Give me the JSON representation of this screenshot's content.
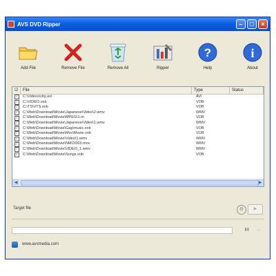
{
  "window": {
    "title": "AVS DVD Ripper"
  },
  "toolbar": {
    "add_file": "Add File",
    "remove_file": "Remove File",
    "remove_all": "Remove All",
    "ripper": "Ripper",
    "help": "Help",
    "about": "About"
  },
  "list": {
    "headers": {
      "file": "File",
      "type": "Type",
      "status": "Status"
    },
    "rows": [
      {
        "file": "C:\\Videos\\clip.avi",
        "type": "AVI"
      },
      {
        "file": "C:\\VIDEO.vob",
        "type": "VOB"
      },
      {
        "file": "C:\\TS\\VTS.vob",
        "type": "VOB"
      },
      {
        "file": "C:\\Web\\Download\\Movie\\Japanese\\Video\\2.wmv",
        "type": "WMV"
      },
      {
        "file": "C:\\Web\\Download\\Movie\\MPEG\\1.m",
        "type": "VOB"
      },
      {
        "file": "C:\\Web\\Download\\Movie\\Japanese\\Video\\1.wmv",
        "type": "WMV"
      },
      {
        "file": "C:\\Web\\Download\\Movie\\Gag\\music.vob",
        "type": "VOB"
      },
      {
        "file": "C:\\Web\\Download\\Movie\\Mov\\Movie.vob",
        "type": "VOB"
      },
      {
        "file": "C:\\Web\\Download\\Movie\\Video\\1.wmv",
        "type": "WMV"
      },
      {
        "file": "C:\\Web\\Download\\Movie\\NMO\\003.mov",
        "type": "WMV"
      },
      {
        "file": "C:\\Web\\Download\\Movie\\VIDEO_1.wmv",
        "type": "WMV"
      },
      {
        "file": "C:\\Web\\Download\\Movie\\Songs.vob",
        "type": "VOB"
      }
    ]
  },
  "target": {
    "label": "Target file"
  },
  "progress": {
    "value": 0
  },
  "footer": {
    "website": "www.avsmedia.com"
  },
  "colors": {
    "titlebar": "#0a5fe0",
    "window_bg": "#ece9d8",
    "accent": "#3c9a3c"
  }
}
